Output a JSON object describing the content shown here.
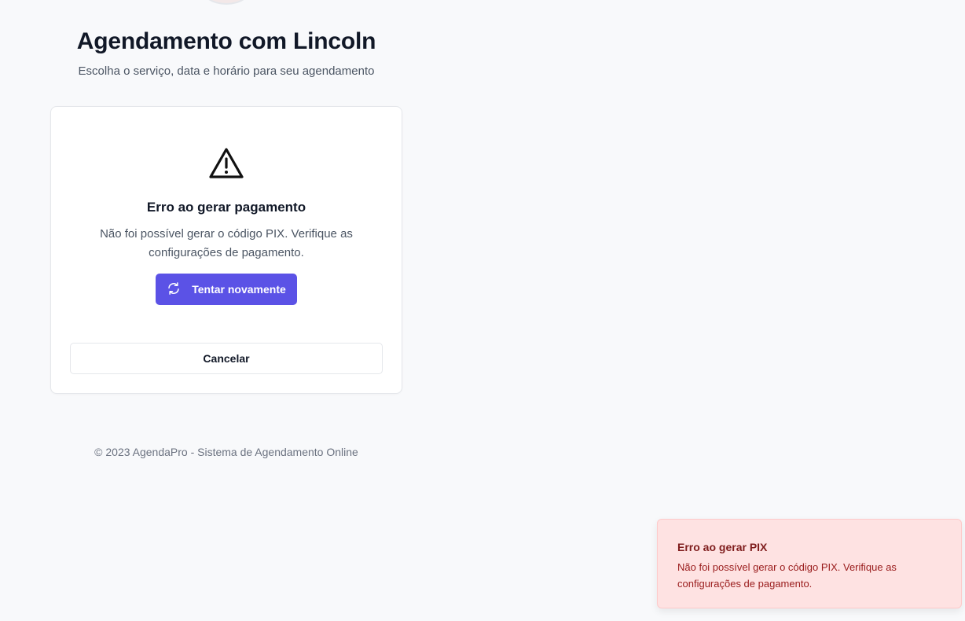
{
  "header": {
    "title": "Agendamento com Lincoln",
    "subtitle": "Escolha o serviço, data e horário para seu agendamento"
  },
  "error_card": {
    "icon": "warning-triangle-icon",
    "title": "Erro ao gerar pagamento",
    "message": "Não foi possível gerar o código PIX. Verifique as configurações de pagamento.",
    "retry_icon": "refresh-icon",
    "retry_label": "Tentar novamente",
    "cancel_label": "Cancelar"
  },
  "footer": {
    "text": "© 2023 AgendaPro - Sistema de Agendamento Online"
  },
  "toast": {
    "title": "Erro ao gerar PIX",
    "message": "Não foi possível gerar o código PIX. Verifique as configurações de pagamento."
  },
  "colors": {
    "primary": "#5b52e6",
    "toast_bg": "#fee2e2",
    "toast_text": "#991b1b",
    "page_bg": "#f8f9fb"
  }
}
